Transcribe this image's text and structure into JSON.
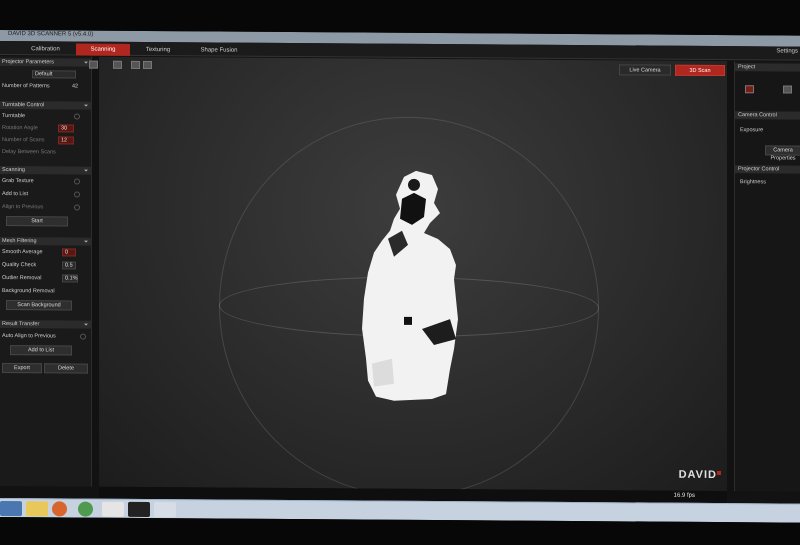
{
  "window": {
    "title": "DAVID 3D SCANNER 5 (v5.4.0)"
  },
  "menu": {
    "tabs": [
      "Calibration",
      "Scanning",
      "Texturing",
      "Shape Fusion"
    ],
    "active_tab": "Scanning",
    "right_item": "Settings"
  },
  "left_panel": {
    "projector_params": {
      "header": "Projector Parameters",
      "preset_value": "Default",
      "num_patterns_label": "Number of Patterns",
      "num_patterns_value": "42"
    },
    "turntable": {
      "header": "Turntable Control",
      "turntable_label": "Turntable",
      "rotation_angle_label": "Rotation Angle",
      "rotation_angle_value": "30",
      "num_steps_label": "Number of Scans",
      "num_steps_value": "12",
      "delay_label": "Delay Between Scans"
    },
    "scanning": {
      "header": "Scanning",
      "grab_texture_label": "Grab Texture",
      "add_to_list_label": "Add to List",
      "align_label": "Align to Previous",
      "start_button": "Start"
    },
    "filtering": {
      "header": "Mesh Filtering",
      "smooth_label": "Smooth Average",
      "smooth_value": "0",
      "quality_label": "Quality Check",
      "quality_value": "0.5",
      "outlier_label": "Outlier Removal",
      "outlier_value": "0.1%",
      "background_label": "Background Removal",
      "scan_background_button": "Scan Background"
    },
    "transfer": {
      "header": "Result Transfer",
      "align_label": "Auto Align to Previous",
      "add_button": "Add to List",
      "export_button": "Export",
      "delete_button": "Delete"
    }
  },
  "viewport": {
    "live_camera_button": "Live Camera",
    "scan_3d_button": "3D Scan",
    "logo": "DAVID",
    "fps": "16.9 fps"
  },
  "right_panel": {
    "project_header": "Project",
    "camera_header": "Camera Control",
    "exposure_label": "Exposure",
    "camera_props_button": "Camera Properties",
    "projector_header": "Projector Control",
    "brightness_label": "Brightness"
  },
  "colors": {
    "accent": "#b0271f",
    "panel": "#1a1a1a",
    "viewport_center": "#3d3d3d",
    "taskbar": "#c6d2e0"
  }
}
